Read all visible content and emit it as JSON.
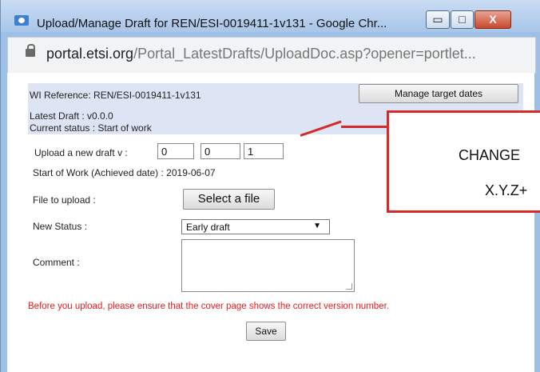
{
  "window": {
    "title": "Upload/Manage Draft for REN/ESI-0019411-1v131 - Google Chr...",
    "controls": {
      "minimize": "▭",
      "maximize": "□",
      "close": "X"
    }
  },
  "address_bar": {
    "domain": "portal.etsi.org",
    "path": "/Portal_LatestDrafts/UploadDoc.asp?opener=portlet..."
  },
  "form": {
    "wi_reference": "WI Reference: REN/ESI-0019411-1v131",
    "manage_target_dates_label": "Manage target dates",
    "latest_draft": "Latest Draft : v0.0.0",
    "current_status": "Current status : Start of work",
    "upload_new_draft_label": "Upload a new draft v :",
    "version": {
      "x": "0",
      "y": "0",
      "z": "1"
    },
    "start_of_work": "Start of Work (Achieved date) : 2019-06-07",
    "file_to_upload_label": "File to upload :",
    "select_file_label": "Select a file",
    "new_status_label": "New Status :",
    "new_status_value": "Early draft",
    "comment_label": "Comment :",
    "comment_value": "",
    "warning": "Before you upload, please ensure that the cover page shows the correct version number.",
    "save_label": "Save"
  },
  "annotation": {
    "line1": "CHANGE",
    "line2": "X.Y.Z+",
    "color": "#d42a2a"
  }
}
